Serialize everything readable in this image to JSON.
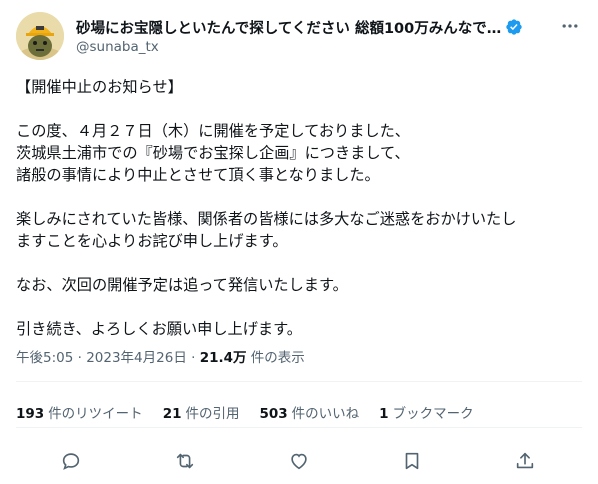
{
  "author": {
    "display_name": "砂場にお宝隠しといたんで探してください 総額100万みんなで…",
    "handle": "@sunaba_tx"
  },
  "tweet": {
    "lines": [
      "【開催中止のお知らせ】",
      "",
      "この度、４月２７日（木）に開催を予定しておりました、",
      "茨城県土浦市での『砂場でお宝探し企画』につきまして、",
      "諸般の事情により中止とさせて頂く事となりました。",
      "",
      "楽しみにされていた皆様、関係者の皆様には多大なご迷惑をおかけいたし",
      "ますことを心よりお詫び申し上げます。",
      "",
      "なお、次回の開催予定は追って発信いたします。",
      "",
      "引き続き、よろしくお願い申し上げます。"
    ]
  },
  "meta": {
    "time_date": "午後5:05 · 2023年4月26日 · ",
    "views": "21.4万",
    "views_label": " 件の表示"
  },
  "stats": {
    "retweets_num": "193",
    "retweets_label": "件のリツイート",
    "quotes_num": "21",
    "quotes_label": "件の引用",
    "likes_num": "503",
    "likes_label": "件のいいね",
    "bookmarks_num": "1",
    "bookmarks_label": "ブックマーク"
  },
  "icons": {
    "verified": "verified-badge-icon",
    "more": "more-icon",
    "reply": "reply-icon",
    "retweet": "retweet-icon",
    "like": "like-icon",
    "bookmark": "bookmark-icon",
    "share": "share-icon"
  },
  "colors": {
    "verified": "#1d9bf0",
    "secondary_text": "#536471",
    "primary_text": "#0f1419"
  }
}
